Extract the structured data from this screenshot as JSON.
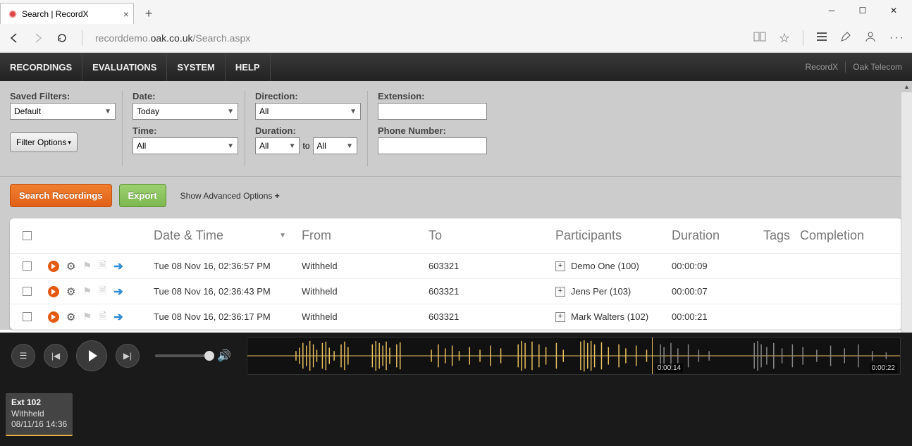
{
  "browser": {
    "tab_title": "Search | RecordX",
    "url_pre": "recorddemo.",
    "url_bold": "oak.co.uk",
    "url_post": "/Search.aspx"
  },
  "nav": {
    "items": [
      "RECORDINGS",
      "EVALUATIONS",
      "SYSTEM",
      "HELP"
    ],
    "brand1": "RecordX",
    "brand2": "Oak Telecom"
  },
  "filters": {
    "saved_filters_label": "Saved Filters:",
    "saved_filters_value": "Default",
    "filter_options": "Filter Options",
    "date_label": "Date:",
    "date_value": "Today",
    "time_label": "Time:",
    "time_value": "All",
    "direction_label": "Direction:",
    "direction_value": "All",
    "duration_label": "Duration:",
    "duration_from": "All",
    "duration_to_word": "to",
    "duration_to": "All",
    "extension_label": "Extension:",
    "phone_label": "Phone Number:"
  },
  "actions": {
    "search": "Search Recordings",
    "export": "Export",
    "advanced": "Show Advanced Options "
  },
  "table": {
    "headers": {
      "date": "Date & Time",
      "from": "From",
      "to": "To",
      "participants": "Participants",
      "duration": "Duration",
      "tags": "Tags",
      "completion": "Completion"
    },
    "rows": [
      {
        "date": "Tue 08 Nov 16, 02:36:57 PM",
        "from": "Withheld",
        "to": "603321",
        "participant": "Demo One (100)",
        "duration": "00:00:09"
      },
      {
        "date": "Tue 08 Nov 16, 02:36:43 PM",
        "from": "Withheld",
        "to": "603321",
        "participant": "Jens Per (103)",
        "duration": "00:00:07"
      },
      {
        "date": "Tue 08 Nov 16, 02:36:17 PM",
        "from": "Withheld",
        "to": "603321",
        "participant": "Mark Walters (102)",
        "duration": "00:00:21"
      }
    ]
  },
  "player": {
    "time_current": "0:00:14",
    "time_total": "0:00:22",
    "chip_ext": "Ext 102",
    "chip_from": "Withheld",
    "chip_date": "08/11/16 14:36"
  }
}
